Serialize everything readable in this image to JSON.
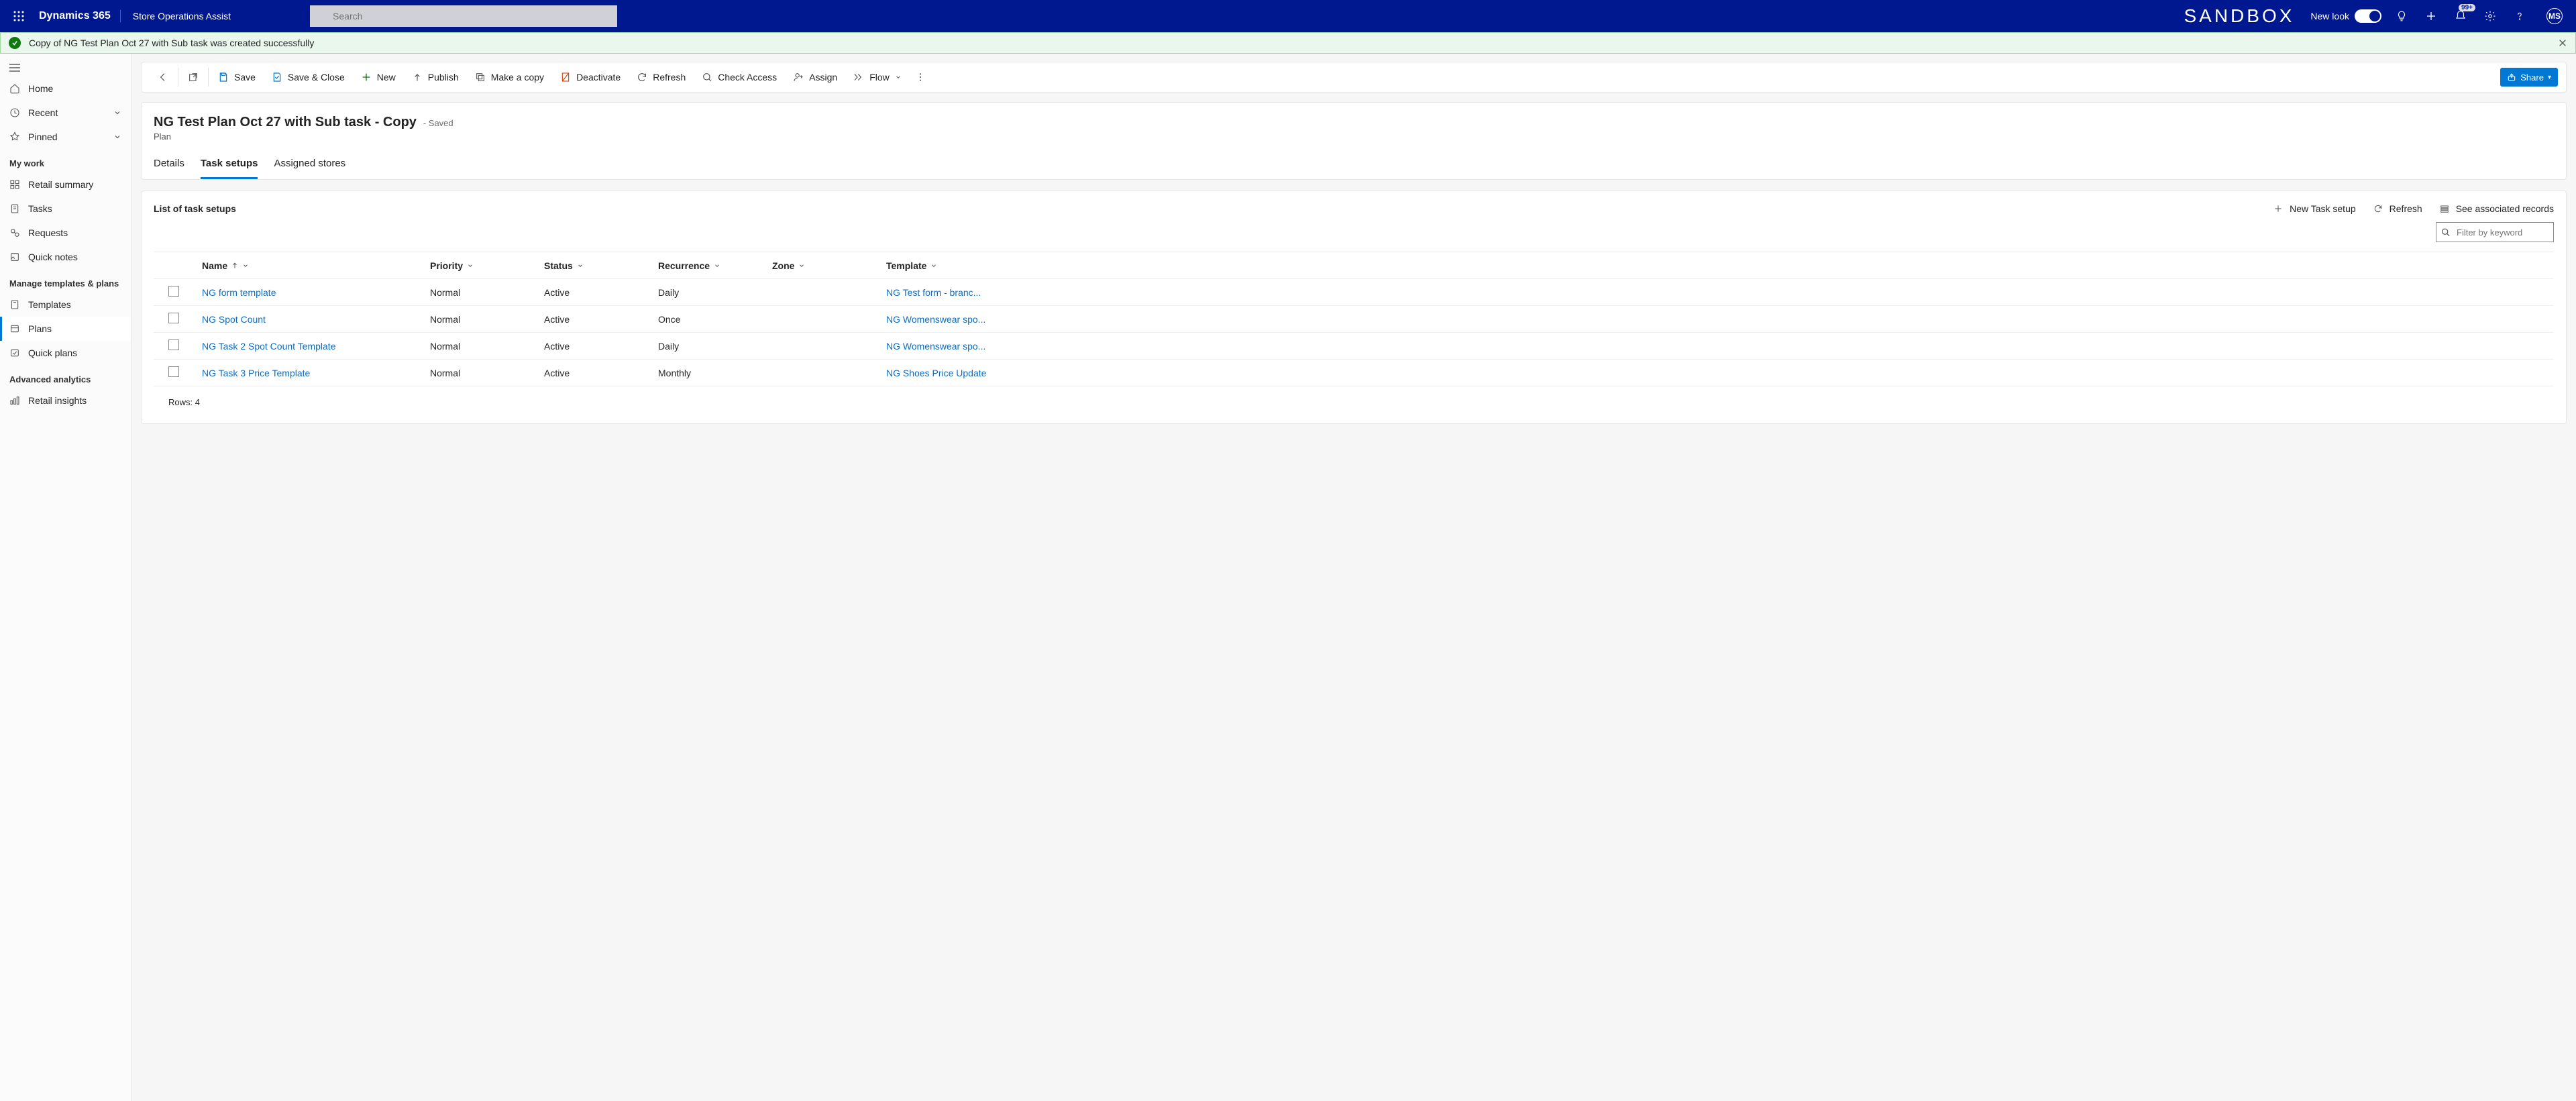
{
  "header": {
    "brand": "Dynamics 365",
    "app": "Store Operations Assist",
    "search_placeholder": "Search",
    "sandbox": "SANDBOX",
    "new_look": "New look",
    "badge": "99+",
    "avatar": "MS"
  },
  "banner": {
    "message": "Copy of NG Test Plan Oct 27 with Sub task was created successfully"
  },
  "sidebar": {
    "home": "Home",
    "recent": "Recent",
    "pinned": "Pinned",
    "section_mywork": "My work",
    "retail_summary": "Retail summary",
    "tasks": "Tasks",
    "requests": "Requests",
    "quick_notes": "Quick notes",
    "section_manage": "Manage templates & plans",
    "templates": "Templates",
    "plans": "Plans",
    "quick_plans": "Quick plans",
    "section_advanced": "Advanced analytics",
    "retail_insights": "Retail insights"
  },
  "commands": {
    "save": "Save",
    "save_close": "Save & Close",
    "new": "New",
    "publish": "Publish",
    "make_copy": "Make a copy",
    "deactivate": "Deactivate",
    "refresh": "Refresh",
    "check_access": "Check Access",
    "assign": "Assign",
    "flow": "Flow",
    "share": "Share"
  },
  "page": {
    "title": "NG Test Plan Oct 27 with Sub task - Copy",
    "saved": "- Saved",
    "entity": "Plan",
    "tabs": {
      "details": "Details",
      "task_setups": "Task setups",
      "assigned_stores": "Assigned stores"
    }
  },
  "subgrid": {
    "title": "List of task setups",
    "new_task": "New Task setup",
    "refresh": "Refresh",
    "associated": "See associated records",
    "filter_placeholder": "Filter by keyword",
    "columns": {
      "name": "Name",
      "priority": "Priority",
      "status": "Status",
      "recurrence": "Recurrence",
      "zone": "Zone",
      "template": "Template"
    },
    "rows": [
      {
        "name": "NG form template",
        "priority": "Normal",
        "status": "Active",
        "recurrence": "Daily",
        "zone": "",
        "template": "NG Test form - branc..."
      },
      {
        "name": "NG Spot Count",
        "priority": "Normal",
        "status": "Active",
        "recurrence": "Once",
        "zone": "",
        "template": "NG Womenswear spo..."
      },
      {
        "name": "NG Task 2 Spot Count Template",
        "priority": "Normal",
        "status": "Active",
        "recurrence": "Daily",
        "zone": "",
        "template": "NG Womenswear spo..."
      },
      {
        "name": "NG Task 3 Price Template",
        "priority": "Normal",
        "status": "Active",
        "recurrence": "Monthly",
        "zone": "",
        "template": "NG Shoes Price Update"
      }
    ],
    "row_count": "Rows: 4"
  }
}
